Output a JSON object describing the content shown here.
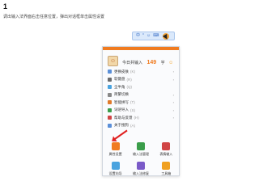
{
  "step_number": "1",
  "instruction": "调出输入法界面右击任意位置，弹出对话框单击属性设置",
  "ime_toolbar": {
    "items": [
      "中",
      "°",
      "☺",
      "⌨"
    ]
  },
  "panel": {
    "avatar_glyph": "☺",
    "today_label": "今日共输入",
    "today_count": "149",
    "today_unit": "字",
    "smile": "☺",
    "menu_items": [
      {
        "label": "更换皮肤",
        "shortcut": "(K)",
        "color": "#5a8fd8",
        "arrow": "›"
      },
      {
        "label": "软键盘",
        "shortcut": "(R)",
        "color": "#6a6a6a",
        "arrow": "›"
      },
      {
        "label": "全半角",
        "shortcut": "(Q)",
        "color": "#4aa3df",
        "arrow": ""
      },
      {
        "label": "简繁切换",
        "shortcut": "",
        "color": "#888888",
        "arrow": "›"
      },
      {
        "label": "智能拼写",
        "shortcut": "(T)",
        "color": "#e07a2a",
        "arrow": "›"
      },
      {
        "label": "词语导入",
        "shortcut": "(S)",
        "color": "#3a9d4a",
        "arrow": "›"
      },
      {
        "label": "帮助与反馈",
        "shortcut": "(H)",
        "color": "#d04545",
        "arrow": "›"
      },
      {
        "label": "关于搜狗",
        "shortcut": "(A)",
        "color": "#5a8fd8",
        "arrow": ""
      }
    ],
    "grid": [
      {
        "label": "属性设置",
        "color": "#f07b1f"
      },
      {
        "label": "输入法管理",
        "color": "#3a9d4a"
      },
      {
        "label": "表情输入",
        "color": "#d04545"
      },
      {
        "label": "设置向导",
        "color": "#4aa3df"
      },
      {
        "label": "输入法修复",
        "color": "#7a5ac8"
      },
      {
        "label": "工具箱",
        "color": "#f0a020"
      }
    ]
  }
}
